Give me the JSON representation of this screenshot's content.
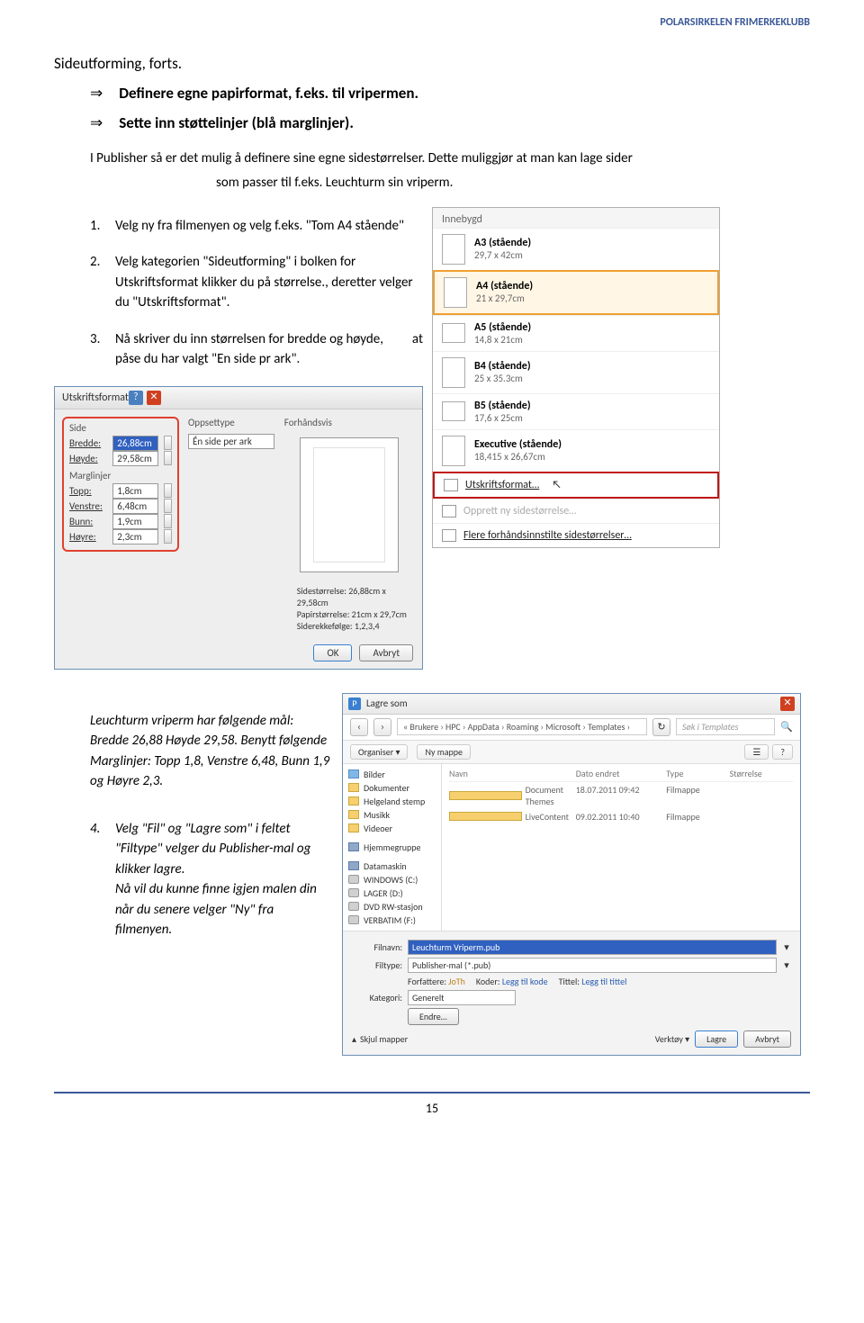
{
  "header": {
    "org": "POLARSIRKELEN FRIMERKEKLUBB"
  },
  "title": "Sideutforming, forts.",
  "arrows": {
    "a": "Definere egne papirformat, f.eks. til vripermen.",
    "b": "Sette inn støttelinjer (blå marglinjer)."
  },
  "intro": {
    "line1": "I Publisher så er det mulig å definere sine egne sidestørrelser. Dette muliggjør at man kan lage sider",
    "line2": "som passer til f.eks. Leuchturm sin vriperm."
  },
  "steps": {
    "s1": "Velg ny fra filmenyen og velg  f.eks. \"Tom A4 stående\"",
    "s2": "Velg kategorien \"Sideutforming\" i bolken for Utskriftsformat klikker du på størrelse., deretter velger du \"Utskriftsformat\".",
    "s3": "Nå skriver du inn størrelsen for bredde og høyde, påse du har valgt \"En side pr ark\".",
    "s3_right": "at"
  },
  "note": {
    "p1": "Leuchturm vriperm har følgende mål: Bredde 26,88 Høyde 29,58. Benytt følgende Marglinjer: Topp 1,8, Venstre  6,48, Bunn 1,9 og Høyre 2,3.",
    "s4a": "Velg \"Fil\"  og \"Lagre som\"  i feltet \"Filtype\" velger du Publisher-mal og klikker lagre.",
    "s4b": "Nå vil du kunne finne igjen malen din når du senere velger \"Ny\" fra filmenyen."
  },
  "dropdown": {
    "head": "Innebygd",
    "items": [
      {
        "title": "A3 (stående)",
        "dim": "29,7 x 42cm"
      },
      {
        "title": "A4 (stående)",
        "dim": "21 x 29,7cm"
      },
      {
        "title": "A5 (stående)",
        "dim": "14,8 x 21cm"
      },
      {
        "title": "B4 (stående)",
        "dim": "25 x 35.3cm"
      },
      {
        "title": "B5 (stående)",
        "dim": "17,6 x 25cm"
      },
      {
        "title": "Executive (stående)",
        "dim": "18,415 x 26,67cm"
      }
    ],
    "link1": "Utskriftsformat…",
    "strike": "Opprett ny sidestørrelse…",
    "link3": "Flere forhåndsinnstilte sidestørrelser…"
  },
  "dlg": {
    "title": "Utskriftsformat",
    "side_head": "Side",
    "bredde_l": "Bredde:",
    "bredde_v": "26,88cm",
    "hoyde_l": "Høyde:",
    "hoyde_v": "29,58cm",
    "marg_head": "Marglinjer",
    "topp_l": "Topp:",
    "topp_v": "1,8cm",
    "venstre_l": "Venstre:",
    "venstre_v": "6,48cm",
    "bunn_l": "Bunn:",
    "bunn_v": "1,9cm",
    "hoyre_l": "Høyre:",
    "hoyre_v": "2,3cm",
    "opp_head": "Oppsettype",
    "opp_val": "Én side per ark",
    "prev_head": "Forhåndsvis",
    "info1": "Sidestørrelse: 26,88cm x 29,58cm",
    "info2": "Papirstørrelse: 21cm x 29,7cm",
    "info3": "Siderekkefølge: 1,2,3,4",
    "ok": "OK",
    "cancel": "Avbryt"
  },
  "save": {
    "title": "Lagre som",
    "breadcrumb": "« Brukere › HPC › AppData › Roaming › Microsoft › Templates ›",
    "search_ph": "Søk i Templates",
    "organize": "Organiser ▾",
    "newfolder": "Ny mappe",
    "side": {
      "bilder": "Bilder",
      "dokumenter": "Dokumenter",
      "helgeland": "Helgeland stemp",
      "musikk": "Musikk",
      "videoer": "Videoer",
      "hjemme": "Hjemmegruppe",
      "datamaskin": "Datamaskin",
      "windows": "WINDOWS (C:)",
      "lager": "LAGER (D:)",
      "dvd": "DVD RW-stasjon",
      "verbatim": "VERBATIM (F:)"
    },
    "cols": {
      "name": "Navn",
      "date": "Dato endret",
      "type": "Type",
      "size": "Størrelse"
    },
    "rows": [
      {
        "name": "Document Themes",
        "date": "18.07.2011 09:42",
        "type": "Filmappe"
      },
      {
        "name": "LiveContent",
        "date": "09.02.2011 10:40",
        "type": "Filmappe"
      }
    ],
    "filnavn_l": "Filnavn:",
    "filnavn_v": "Leuchturm Vriperm.pub",
    "filtype_l": "Filtype:",
    "filtype_v": "Publisher-mal (*.pub)",
    "forfattere_l": "Forfattere:",
    "forfattere_v": "JoTh",
    "koder_l": "Koder:",
    "koder_v": "Legg til kode",
    "tittel_l": "Tittel:",
    "tittel_v": "Legg til tittel",
    "kategori_l": "Kategori:",
    "kategori_v": "Generelt",
    "endre": "Endre…",
    "hide": "Skjul mapper",
    "verktoy": "Verktøy  ▾",
    "lagre": "Lagre",
    "avbryt": "Avbryt",
    "p_ico": "P"
  },
  "footer": {
    "page": "15"
  }
}
